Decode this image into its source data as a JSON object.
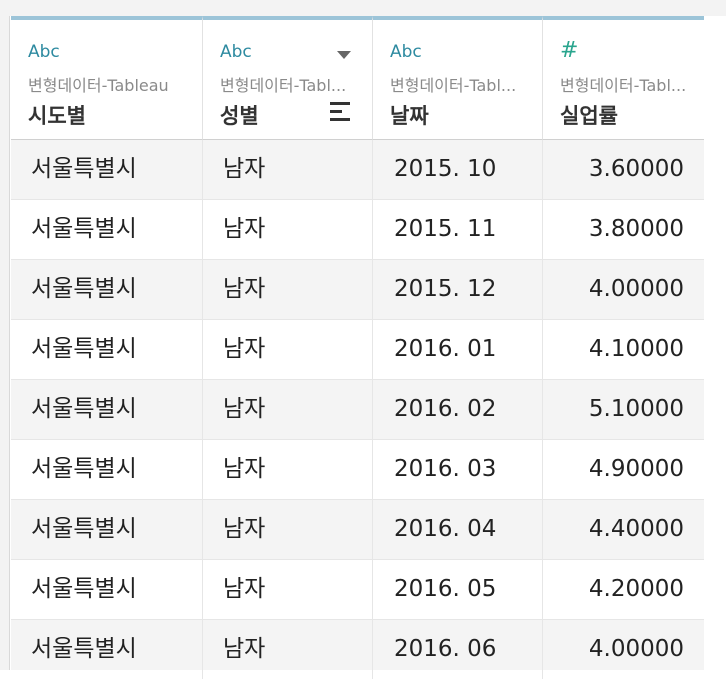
{
  "columns": [
    {
      "type": "Abc",
      "source": "변형데이터-Tableau",
      "title": "시도별"
    },
    {
      "type": "Abc",
      "source": "변형데이터-Tabl...",
      "title": "성별"
    },
    {
      "type": "Abc",
      "source": "변형데이터-Tabl...",
      "title": "날짜"
    },
    {
      "type": "#",
      "source": "변형데이터-Tabl...",
      "title": "실업률"
    }
  ],
  "rows": [
    {
      "region": "서울특별시",
      "gender": "남자",
      "date": "2015. 10",
      "rate": "3.60000"
    },
    {
      "region": "서울특별시",
      "gender": "남자",
      "date": "2015. 11",
      "rate": "3.80000"
    },
    {
      "region": "서울특별시",
      "gender": "남자",
      "date": "2015. 12",
      "rate": "4.00000"
    },
    {
      "region": "서울특별시",
      "gender": "남자",
      "date": "2016. 01",
      "rate": "4.10000"
    },
    {
      "region": "서울특별시",
      "gender": "남자",
      "date": "2016. 02",
      "rate": "5.10000"
    },
    {
      "region": "서울특별시",
      "gender": "남자",
      "date": "2016. 03",
      "rate": "4.90000"
    },
    {
      "region": "서울특별시",
      "gender": "남자",
      "date": "2016. 04",
      "rate": "4.40000"
    },
    {
      "region": "서울특별시",
      "gender": "남자",
      "date": "2016. 05",
      "rate": "4.20000"
    },
    {
      "region": "서울특별시",
      "gender": "남자",
      "date": "2016. 06",
      "rate": "4.00000"
    }
  ],
  "icons": {
    "sort": "sort-icon",
    "dropdown": "dropdown-caret-icon"
  },
  "colors": {
    "header_accent": "#9cc4d8",
    "string_type": "#2d8aa0",
    "number_type": "#2aa58e",
    "row_shade": "#f4f4f4"
  }
}
